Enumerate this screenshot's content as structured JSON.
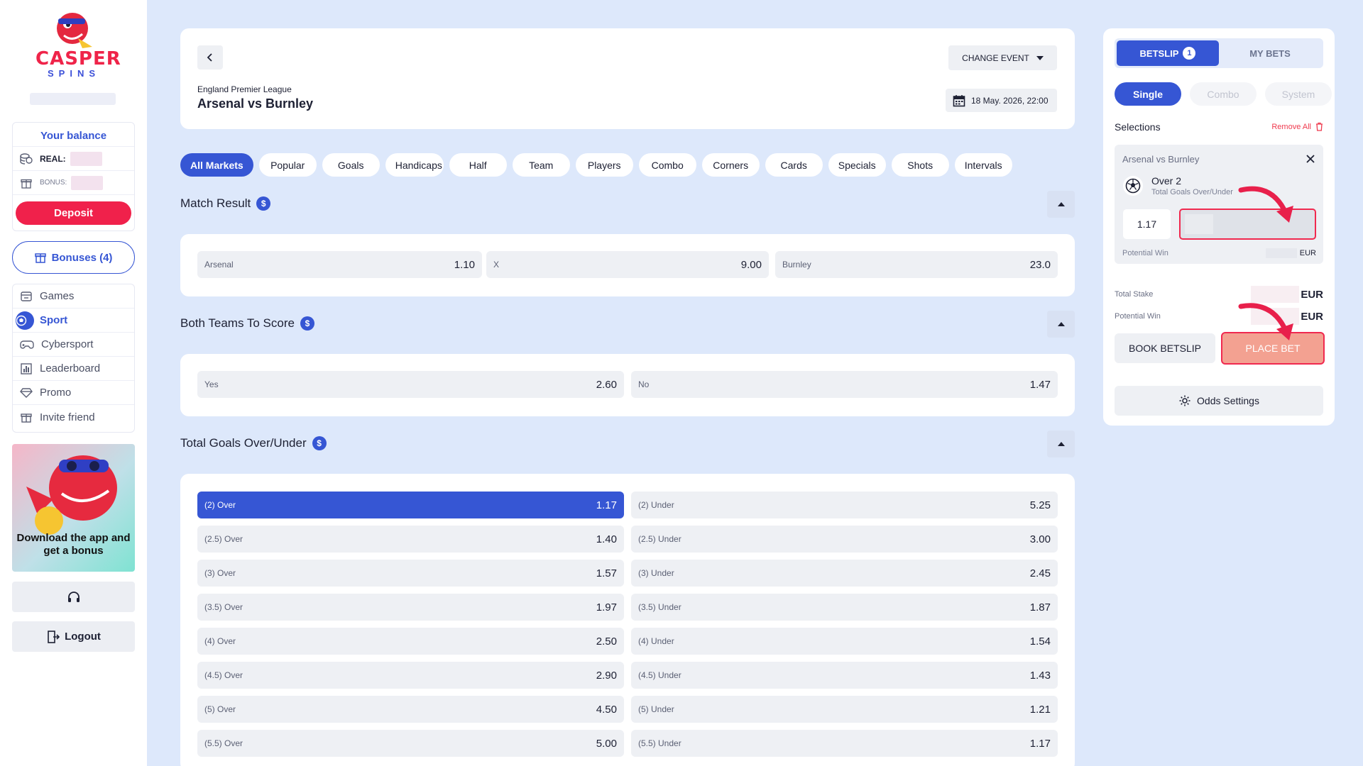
{
  "brand": {
    "logo_text": "CASPER",
    "logo_sub": "SPINS"
  },
  "balance": {
    "title": "Your balance",
    "real_label": "REAL:",
    "bonus_label": "BONUS:",
    "deposit_label": "Deposit"
  },
  "bonuses_label": "Bonuses (4)",
  "nav": {
    "items": [
      {
        "label": "Games",
        "icon": "games-icon"
      },
      {
        "label": "Sport",
        "icon": "sport-icon",
        "active": true
      },
      {
        "label": "Cybersport",
        "icon": "gamepad-icon"
      },
      {
        "label": "Leaderboard",
        "icon": "leaderboard-icon"
      },
      {
        "label": "Promo",
        "icon": "diamond-icon"
      },
      {
        "label": "Invite friend",
        "icon": "gift-icon"
      }
    ]
  },
  "promo": {
    "text": "Download the app and get a bonus"
  },
  "logout_label": "Logout",
  "event": {
    "league": "England Premier League",
    "title": "Arsenal vs Burnley",
    "change_event": "CHANGE EVENT",
    "date": "18 May. 2026, 22:00"
  },
  "tabs": [
    "All Markets",
    "Popular",
    "Goals",
    "Handicaps",
    "Half",
    "Team",
    "Players",
    "Combo",
    "Corners",
    "Cards",
    "Specials",
    "Shots",
    "Intervals"
  ],
  "markets": {
    "match_result": {
      "title": "Match Result",
      "odds": [
        {
          "label": "Arsenal",
          "value": "1.10"
        },
        {
          "label": "X",
          "value": "9.00"
        },
        {
          "label": "Burnley",
          "value": "23.0"
        }
      ]
    },
    "btts": {
      "title": "Both Teams To Score",
      "odds": [
        {
          "label": "Yes",
          "value": "2.60"
        },
        {
          "label": "No",
          "value": "1.47"
        }
      ]
    },
    "totals": {
      "title": "Total Goals Over/Under",
      "rows": [
        {
          "over_label": "(2) Over",
          "over": "1.17",
          "under_label": "(2) Under",
          "under": "5.25",
          "selected": "over"
        },
        {
          "over_label": "(2.5) Over",
          "over": "1.40",
          "under_label": "(2.5) Under",
          "under": "3.00"
        },
        {
          "over_label": "(3) Over",
          "over": "1.57",
          "under_label": "(3) Under",
          "under": "2.45"
        },
        {
          "over_label": "(3.5) Over",
          "over": "1.97",
          "under_label": "(3.5) Under",
          "under": "1.87"
        },
        {
          "over_label": "(4) Over",
          "over": "2.50",
          "under_label": "(4) Under",
          "under": "1.54"
        },
        {
          "over_label": "(4.5) Over",
          "over": "2.90",
          "under_label": "(4.5) Under",
          "under": "1.43"
        },
        {
          "over_label": "(5) Over",
          "over": "4.50",
          "under_label": "(5) Under",
          "under": "1.21"
        },
        {
          "over_label": "(5.5) Over",
          "over": "5.00",
          "under_label": "(5.5) Under",
          "under": "1.17"
        }
      ]
    }
  },
  "betslip": {
    "tab_betslip": "BETSLIP",
    "count": "1",
    "tab_mybets": "MY BETS",
    "types": [
      "Single",
      "Combo",
      "System"
    ],
    "selections_label": "Selections",
    "remove_all": "Remove All",
    "selection": {
      "match": "Arsenal vs Burnley",
      "outcome": "Over  2",
      "market": "Total Goals Over/Under",
      "odd": "1.17",
      "potential_win_label": "Potential Win",
      "currency": "EUR"
    },
    "total_stake_label": "Total Stake",
    "potential_win_label": "Potential Win",
    "currency": "EUR",
    "book_label": "BOOK BETSLIP",
    "place_label": "PLACE BET",
    "odds_settings": "Odds Settings"
  },
  "colors": {
    "accent": "#3656d4",
    "brand_red": "#f0214b",
    "background": "#dde8fb"
  }
}
